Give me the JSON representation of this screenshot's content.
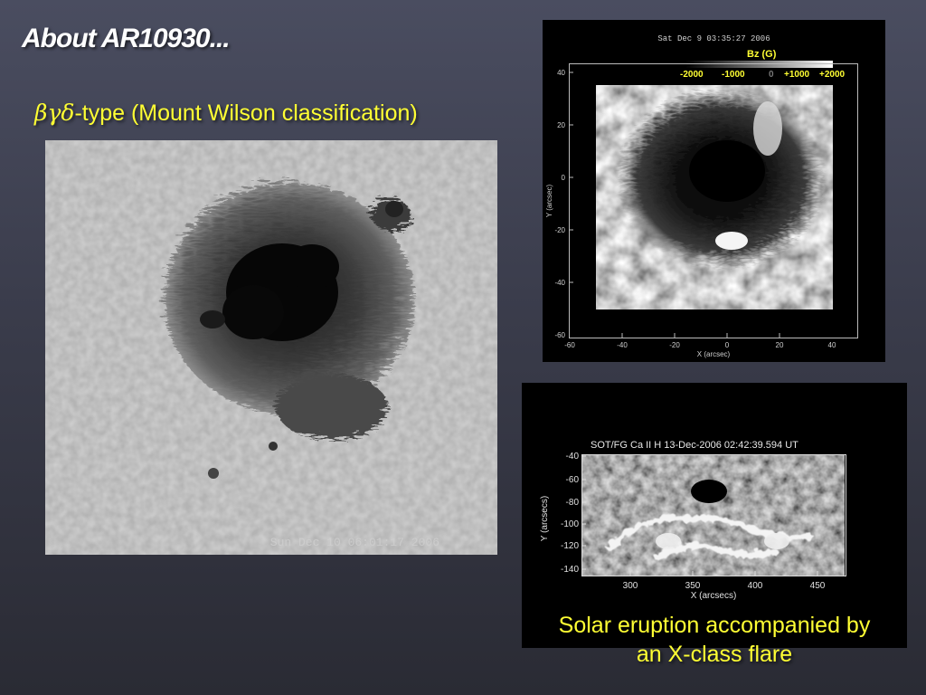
{
  "slide": {
    "title": "About AR10930...",
    "subtitle_greek": "βγδ",
    "subtitle_rest": "-type (Mount Wilson classification)",
    "caption_line1": "Solar eruption accompanied by",
    "caption_line2": "an X-class flare"
  },
  "sunspot_panel": {
    "timestamp": "Sun Dec 10 06:01:17 2006"
  },
  "magnetogram_panel": {
    "observation_time": "Sat Dec  9 03:35:27 2006",
    "colorbar_title": "Bz (G)",
    "colorbar_ticks": [
      "-2000",
      "-1000",
      "0",
      "+1000",
      "+2000"
    ],
    "x_label": "X (arcsec)",
    "y_label": "Y (arcsec)",
    "x_ticks": [
      "-60",
      "-40",
      "-20",
      "0",
      "20",
      "40"
    ],
    "y_ticks": [
      "40",
      "20",
      "0",
      "-20",
      "-40",
      "-60"
    ]
  },
  "flare_panel": {
    "title": "SOT/FG Ca II H 13-Dec-2006 02:42:39.594 UT",
    "x_label": "X (arcsecs)",
    "y_label": "Y (arcsecs)",
    "x_ticks": [
      "300",
      "350",
      "400",
      "450"
    ],
    "y_ticks": [
      "-40",
      "-60",
      "-80",
      "-100",
      "-120",
      "-140"
    ]
  },
  "colors": {
    "title_text": "#ffffff",
    "accent_yellow": "#ffff33",
    "background_top": "#4a4d60",
    "background_bottom": "#2a2b34"
  }
}
